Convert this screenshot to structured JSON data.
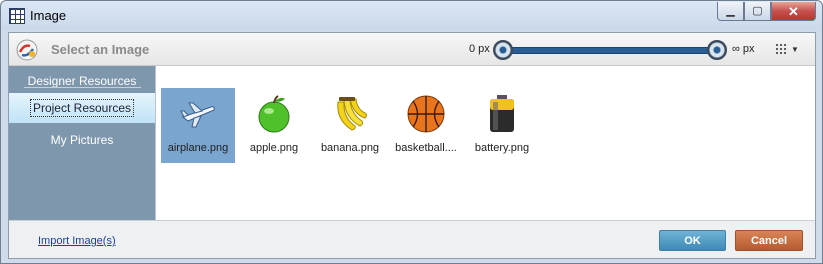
{
  "window": {
    "title": "Image",
    "icon": "grid-table-icon",
    "controls": {
      "minimize": "▁",
      "maximize": "▢",
      "close": "✕"
    }
  },
  "toolbar": {
    "app_icon": "app-logo-icon",
    "title": "Select an Image",
    "zoom_min_label": "0 px",
    "zoom_max_label": "∞ px",
    "zoom_slider": {
      "min_value_fraction": 0.0,
      "max_value_fraction": 1.0
    },
    "view_icon": "grid-view-icon",
    "view_caret": "▼"
  },
  "sidebar": {
    "items": [
      {
        "label": "Designer Resources",
        "active": false
      },
      {
        "label": "Project Resources",
        "active": true
      },
      {
        "label": "My Pictures",
        "active": false
      }
    ]
  },
  "files": [
    {
      "name": "airplane.png",
      "icon": "airplane-icon",
      "selected": true
    },
    {
      "name": "apple.png",
      "icon": "apple-icon",
      "selected": false
    },
    {
      "name": "banana.png",
      "icon": "banana-icon",
      "selected": false
    },
    {
      "name": "basketball....",
      "icon": "basketball-icon",
      "selected": false
    },
    {
      "name": "battery.png",
      "icon": "battery-icon",
      "selected": false
    }
  ],
  "footer": {
    "import_label": "Import Image(s)",
    "ok_label": "OK",
    "cancel_label": "Cancel"
  },
  "colors": {
    "selection": "#7aa5cf",
    "sidebar": "#7f97ad",
    "ok_button": "#4f9cc6",
    "cancel_button": "#c66d40",
    "slider": "#2a5d93"
  }
}
